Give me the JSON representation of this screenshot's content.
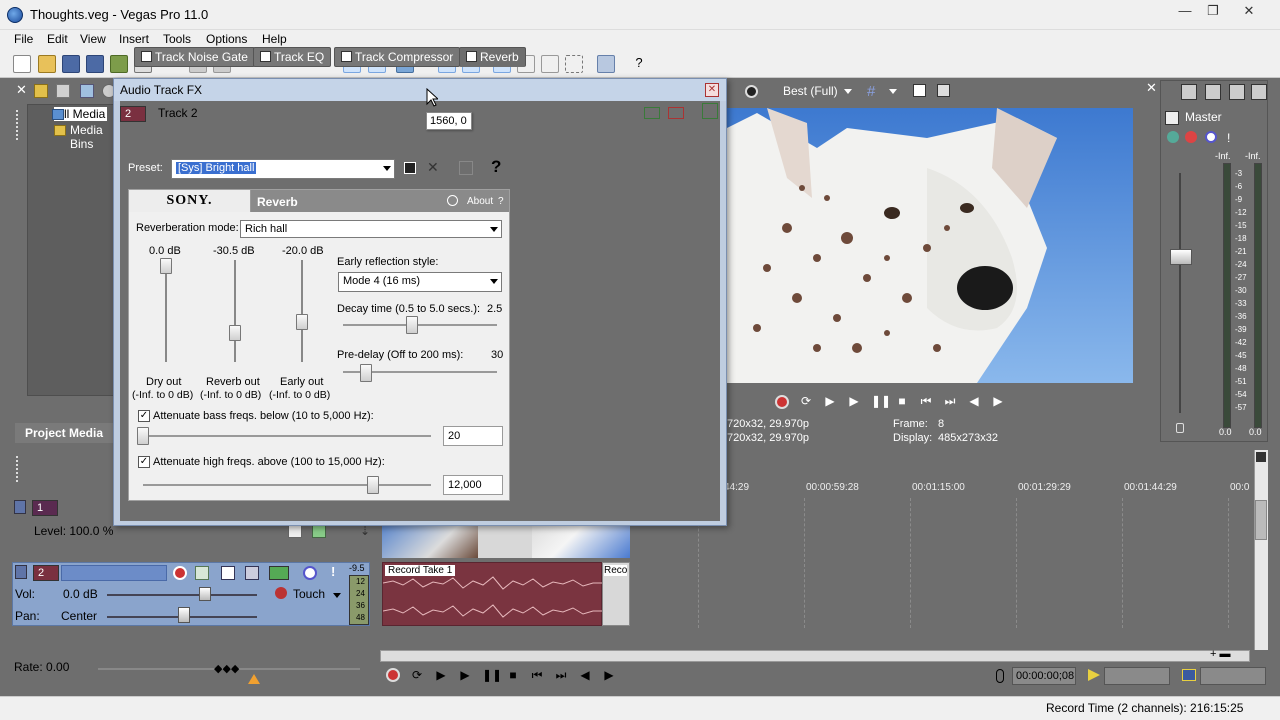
{
  "window": {
    "title": "Thoughts.veg - Vegas Pro 11.0",
    "min": "—",
    "max": "❐",
    "close": "✕"
  },
  "menu": [
    "File",
    "Edit",
    "View",
    "Insert",
    "Tools",
    "Options",
    "Help"
  ],
  "project_media": {
    "tree": [
      "All Media",
      "Media Bins"
    ],
    "tab": "Project Media"
  },
  "preview": {
    "quality": "Best (Full)",
    "frame_label": "Frame:",
    "frame_value": "8",
    "display_label": "Display:",
    "display_value": "485x273x32",
    "project_line1": "720x32, 29.970p",
    "project_line2": "720x32, 29.970p"
  },
  "master": {
    "title": "Master",
    "left_top": "-Inf.",
    "right_top": "-Inf.",
    "scale": [
      "3",
      "6",
      "9",
      "12",
      "15",
      "18",
      "21",
      "24",
      "27",
      "30",
      "33",
      "36",
      "39",
      "42",
      "45",
      "48",
      "51",
      "54",
      "57"
    ],
    "left_bottom": "0.0",
    "right_bottom": "0.0"
  },
  "dialog": {
    "title": "Audio Track FX",
    "close": "✕",
    "track_num": "2",
    "track_name": "Track 2",
    "tabs": [
      "Track Noise Gate",
      "Track EQ",
      "Track Compressor",
      "Reverb"
    ],
    "preset_label": "Preset:",
    "preset_value": "[Sys] Bright hall",
    "help": "?",
    "plugin": {
      "brand": "SONY.",
      "name": "Reverb",
      "about": "About",
      "about_q": "?",
      "reverb_mode_label": "Reverberation mode:",
      "reverb_mode_value": "Rich hall",
      "dry_db": "0.0 dB",
      "reverb_db": "-30.5 dB",
      "early_db": "-20.0 dB",
      "dry_label": "Dry out",
      "reverb_label": "Reverb out",
      "early_label": "Early out",
      "range": "(-Inf. to 0 dB)",
      "early_style_label": "Early reflection style:",
      "early_style_value": "Mode 4  (16 ms)",
      "decay_label": "Decay time (0.5 to 5.0 secs.):",
      "decay_value": "2.5",
      "predelay_label": "Pre-delay (Off to 200 ms):",
      "predelay_value": "30",
      "bass_label": "Attenuate bass freqs. below (10 to 5,000 Hz):",
      "bass_value": "20",
      "high_label": "Attenuate high freqs. above (100 to 15,000 Hz):",
      "high_value": "12,000",
      "check": "✓"
    }
  },
  "tooltip": "1560, 0",
  "timeline": {
    "ticks": [
      "44:29",
      "00:00:59:28",
      "00:01:15:00",
      "00:01:29:29",
      "00:01:44:29",
      "00:0"
    ],
    "track1": {
      "num": "1",
      "level": "Level: 100.0 %"
    },
    "track2": {
      "num": "2",
      "vol_label": "Vol:",
      "vol_value": "0.0 dB",
      "pan_label": "Pan:",
      "pan_value": "Center",
      "mode": "Touch",
      "meter_top": "-9.5",
      "meter_scale": [
        "12",
        "24",
        "36",
        "48"
      ]
    },
    "clip_label": "Record Take 1",
    "clip_label2": "Reco"
  },
  "bottom": {
    "rate": "Rate: 0.00",
    "timecode": "00:00:00;08",
    "record_time": "Record Time (2 channels): 216:15:25"
  }
}
